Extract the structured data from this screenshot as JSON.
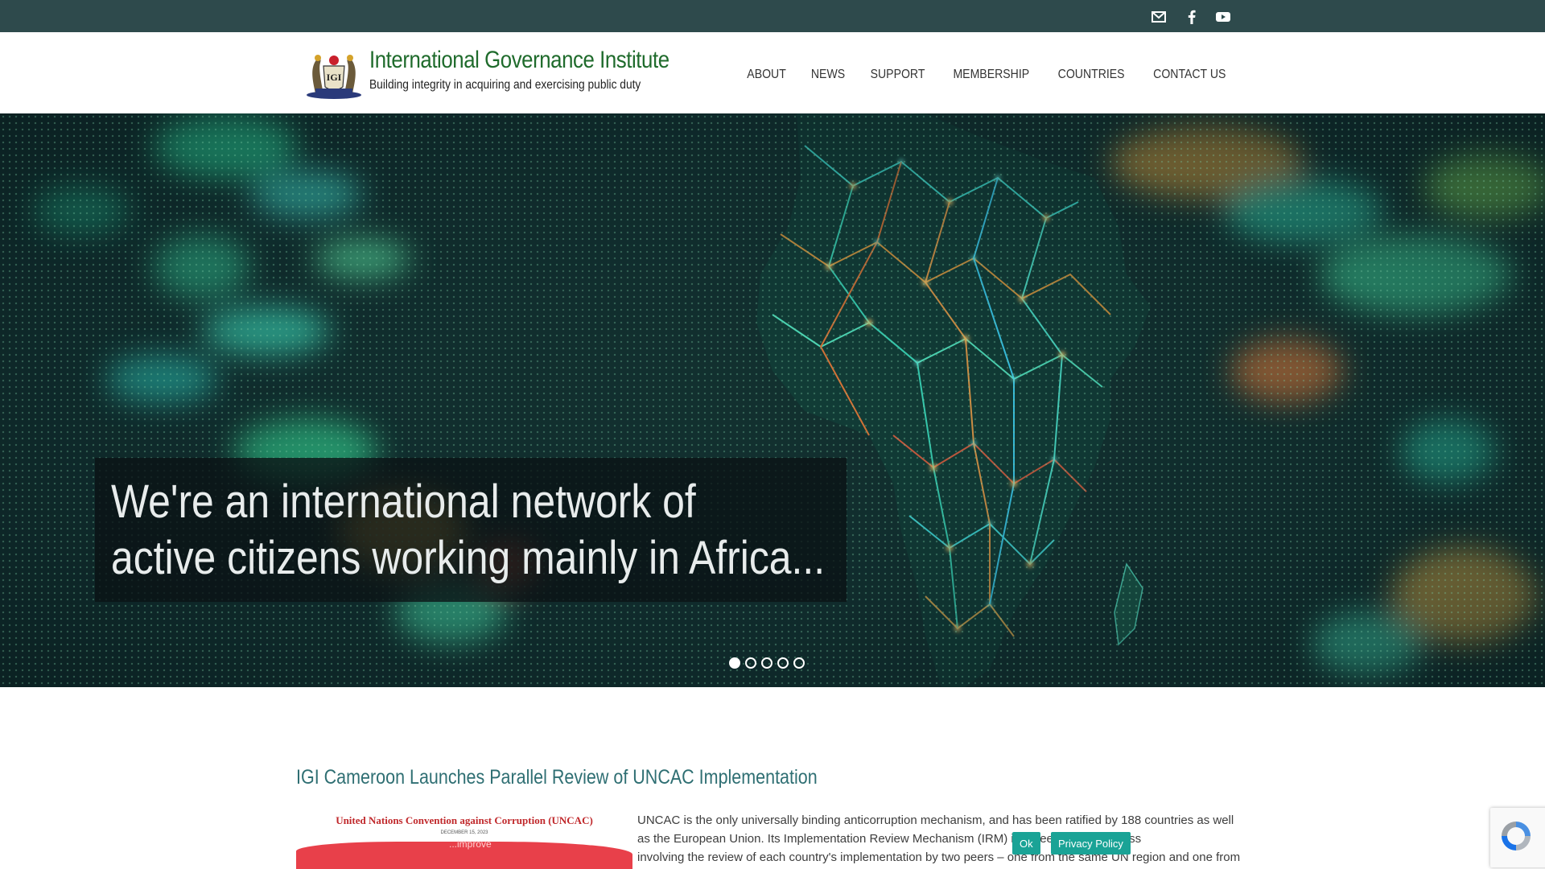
{
  "topbar": {
    "icons": [
      {
        "name": "email-icon",
        "label": "Email"
      },
      {
        "name": "facebook-icon",
        "label": "Facebook"
      },
      {
        "name": "youtube-icon",
        "label": "YouTube"
      }
    ],
    "background": "#2e4a4c"
  },
  "header": {
    "title": "International Governance Institute",
    "tagline": "Building integrity in acquiring and exercising public duty",
    "logo": "igi-crest-logo",
    "title_color": "#1f6b2c"
  },
  "nav": {
    "items": [
      "ABOUT",
      "NEWS",
      "SUPPORT",
      "MEMBERSHIP",
      "COUNTRIES",
      "CONTACT US"
    ]
  },
  "hero": {
    "caption_line1": "We're an international network of",
    "caption_line2": "active citizens working mainly in Africa...",
    "slides_total": 5,
    "active_slide": 1
  },
  "article": {
    "title": "IGI Cameroon Launches Parallel Review of UNCAC Implementation",
    "image_caption": "United Nations Convention against Corruption (UNCAC)",
    "image_date": "DECEMBER 15, 2023",
    "image_overlay_text": "...improve",
    "body_line1": "UNCAC is the only universally binding anticorruption mechanism, and has been ratified by 188 countries as well",
    "body_line2": "as the European Union. Its Implementation Review Mechanism (IRM) is a peer review process",
    "body_line3": "involving the review of each country's implementation by two peers – one from the same UN region and one from",
    "title_color": "#2f6f73"
  },
  "cookie": {
    "ok_label": "Ok",
    "privacy_label": "Privacy Policy",
    "button_color": "#1aa396"
  },
  "recaptcha": {
    "icon": "recaptcha-icon"
  }
}
